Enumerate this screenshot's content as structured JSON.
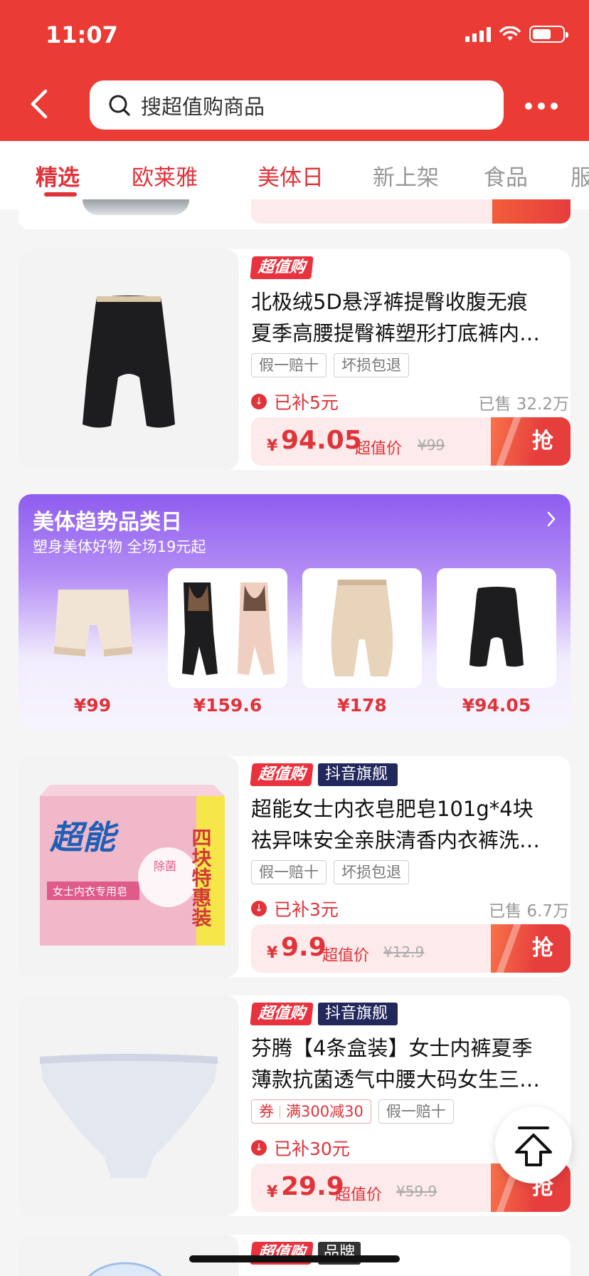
{
  "status_bar": {
    "time": "11:07"
  },
  "search": {
    "placeholder": "搜超值购商品"
  },
  "tabs": [
    {
      "label": "精选",
      "state": "active"
    },
    {
      "label": "欧莱雅",
      "state": "highlight"
    },
    {
      "label": "美体日",
      "state": "highlight"
    },
    {
      "label": "新上架",
      "state": "normal"
    },
    {
      "label": "食品",
      "state": "normal"
    },
    {
      "label": "服",
      "state": "normal"
    }
  ],
  "products": [
    {
      "badges": {
        "chaozhigou": "超值购"
      },
      "title_line1": "北极绒5D悬浮裤提臀收腹无痕",
      "title_line2": "夏季高腰提臀裤塑形打底裤内…",
      "tags": [
        "假一赔十",
        "坏损包退"
      ],
      "subsidy": "已补5元",
      "sold": "已售 32.2万",
      "currency": "¥",
      "price": "94.05",
      "price_label": "超值价",
      "original_price": "¥99",
      "grab": "抢"
    },
    {
      "badges": {
        "chaozhigou": "超值购",
        "douyin": "抖音旗舰"
      },
      "title_line1": "超能女士内衣皂肥皂101g*4块",
      "title_line2": "祛异味安全亲肤清香内衣裤洗…",
      "tags": [
        "假一赔十",
        "坏损包退"
      ],
      "subsidy": "已补3元",
      "sold": "已售 6.7万",
      "currency": "¥",
      "price": "9.9",
      "price_label": "超值价",
      "original_price": "¥12.9",
      "grab": "抢",
      "image_text": {
        "brand": "超能",
        "tag": "女士内衣专用皂",
        "side": "四块特惠装",
        "badge": "除菌"
      }
    },
    {
      "badges": {
        "chaozhigou": "超值购",
        "douyin": "抖音旗舰"
      },
      "title_line1": "芬腾【4条盒装】女士内裤夏季",
      "title_line2": "薄款抗菌透气中腰大码女生三…",
      "coupon": {
        "label": "券",
        "text": "满300减30"
      },
      "tags": [
        "假一赔十"
      ],
      "subsidy": "已补30元",
      "currency": "¥",
      "price": "29.9",
      "price_label": "超值价",
      "original_price": "¥59.9",
      "grab": "抢"
    },
    {
      "badges": {
        "chaozhigou": "超值购",
        "brand": "品牌"
      }
    }
  ],
  "promo": {
    "title": "美体趋势品类日",
    "subtitle": "塑身美体好物 全场19元起",
    "items": [
      {
        "price": "¥99"
      },
      {
        "price": "¥159.6"
      },
      {
        "price": "¥178"
      },
      {
        "price": "¥94.05"
      }
    ]
  }
}
